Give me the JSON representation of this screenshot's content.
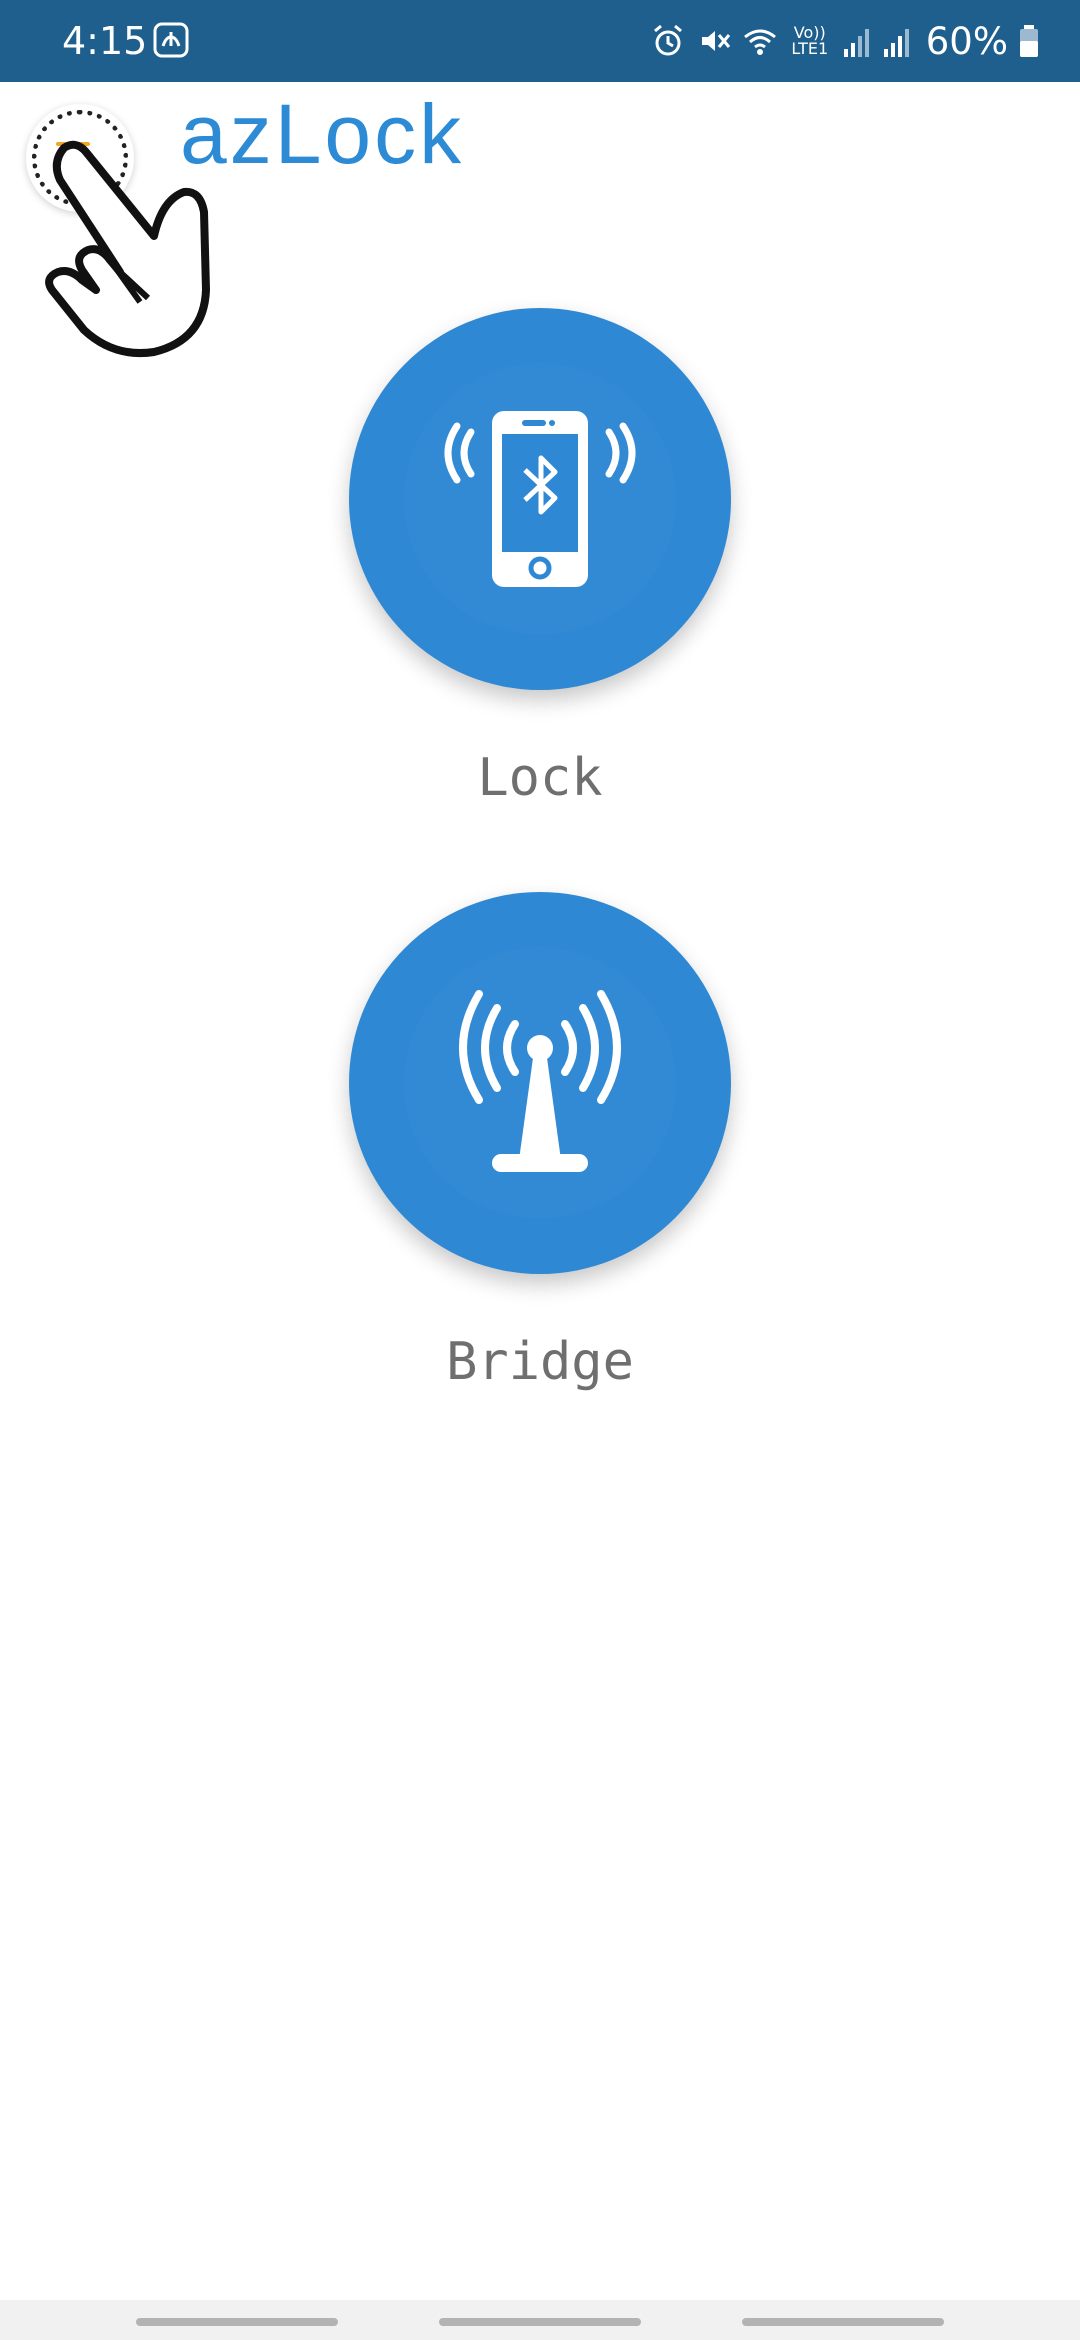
{
  "status_bar": {
    "time": "4:15",
    "lte": "Vo)) LTE1",
    "battery": "60%"
  },
  "header": {
    "logo_text": "azLock",
    "menu_icon": "hamburger-icon",
    "accent_color": "#f2a52b",
    "brand_color": "#2d8bd6"
  },
  "actions": [
    {
      "label": "Lock",
      "icon": "bluetooth-phone-icon"
    },
    {
      "label": "Bridge",
      "icon": "wifi-tower-icon"
    }
  ],
  "colors": {
    "status_bar": "#1f5f8e",
    "circle": "#2e88d3",
    "label": "#6f6f6f"
  }
}
